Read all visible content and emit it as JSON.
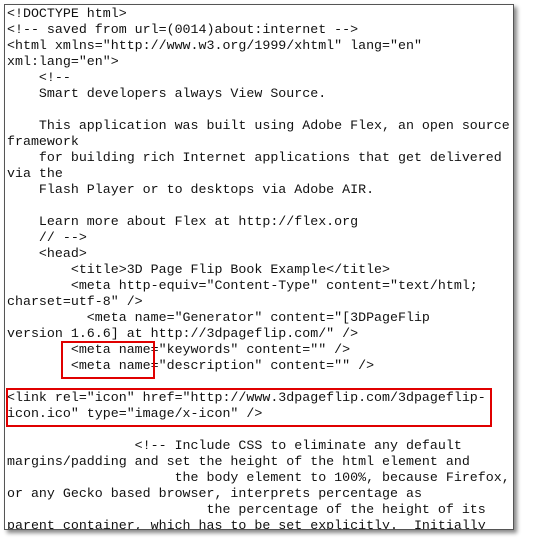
{
  "source_lines": [
    "<!DOCTYPE html>",
    "<!-- saved from url=(0014)about:internet -->",
    "<html xmlns=\"http://www.w3.org/1999/xhtml\" lang=\"en\"",
    "xml:lang=\"en\">",
    "    <!--",
    "    Smart developers always View Source.",
    "",
    "    This application was built using Adobe Flex, an open source",
    "framework",
    "    for building rich Internet applications that get delivered",
    "via the",
    "    Flash Player or to desktops via Adobe AIR.",
    "",
    "    Learn more about Flex at http://flex.org",
    "    // -->",
    "    <head>",
    "        <title>3D Page Flip Book Example</title>",
    "        <meta http-equiv=\"Content-Type\" content=\"text/html;",
    "charset=utf-8\" />",
    "          <meta name=\"Generator\" content=\"[3DPageFlip",
    "version 1.6.6] at http://3dpageflip.com/\" />",
    "        <meta name=\"keywords\" content=\"\" />",
    "        <meta name=\"description\" content=\"\" />",
    "",
    "<link rel=\"icon\" href=\"http://www.3dpageflip.com/3dpageflip-",
    "icon.ico\" type=\"image/x-icon\" />",
    "",
    "                <!-- Include CSS to eliminate any default",
    "margins/padding and set the height of the html element and",
    "                     the body element to 100%, because Firefox,",
    "or any Gecko based browser, interprets percentage as",
    "                         the percentage of the height of its",
    "parent container, which has to be set explicitly.  Initially"
  ],
  "highlight_color": "#e00000"
}
